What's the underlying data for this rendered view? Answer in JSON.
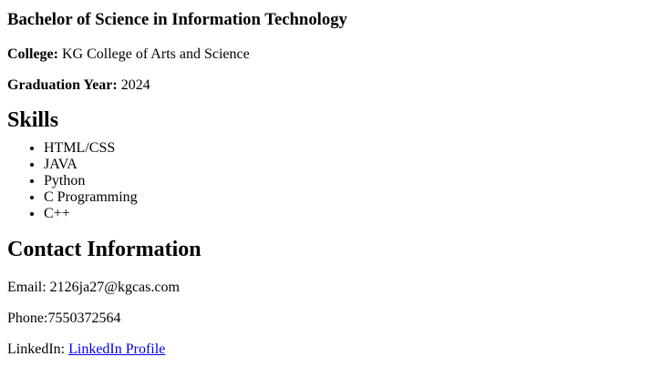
{
  "education": {
    "degree": "Bachelor of Science in Information Technology",
    "college_label": "College:",
    "college_value": " KG College of Arts and Science",
    "grad_label": "Graduation Year:",
    "grad_value": " 2024"
  },
  "skills": {
    "title": "Skills",
    "items": [
      "HTML/CSS",
      "JAVA",
      "Python",
      "C Programming",
      "C++"
    ]
  },
  "contact": {
    "title": "Contact Information",
    "email_text": "Email: 2126ja27@kgcas.com",
    "phone_text": "Phone:7550372564",
    "linkedin_prefix": "LinkedIn: ",
    "linkedin_link": "LinkedIn Profile"
  },
  "colors": {
    "text": "#000000",
    "link": "#0000ee"
  }
}
